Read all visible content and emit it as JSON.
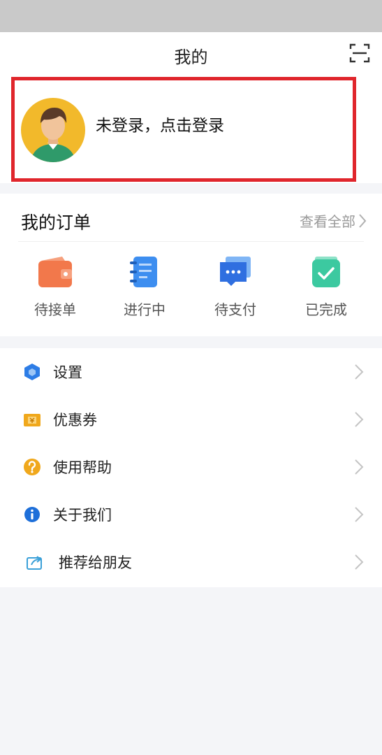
{
  "header": {
    "title": "我的"
  },
  "login": {
    "prompt": "未登录，点击登录"
  },
  "orders": {
    "title": "我的订单",
    "view_all": "查看全部",
    "items": [
      {
        "label": "待接单",
        "icon": "wallet-icon",
        "color": "#f2784b"
      },
      {
        "label": "进行中",
        "icon": "notebook-icon",
        "color": "#3d8ef0"
      },
      {
        "label": "待支付",
        "icon": "chat-icon",
        "color": "#2f6fe0"
      },
      {
        "label": "已完成",
        "icon": "check-icon",
        "color": "#3cc9a0"
      }
    ]
  },
  "menu": {
    "items": [
      {
        "label": "设置",
        "icon": "settings-hexagon-icon"
      },
      {
        "label": "优惠券",
        "icon": "coupon-icon"
      },
      {
        "label": "使用帮助",
        "icon": "help-icon"
      },
      {
        "label": "关于我们",
        "icon": "info-icon"
      },
      {
        "label": "推荐给朋友",
        "icon": "share-icon"
      }
    ]
  },
  "colors": {
    "highlight": "#e0262c",
    "avatar_bg": "#f2b92b"
  }
}
